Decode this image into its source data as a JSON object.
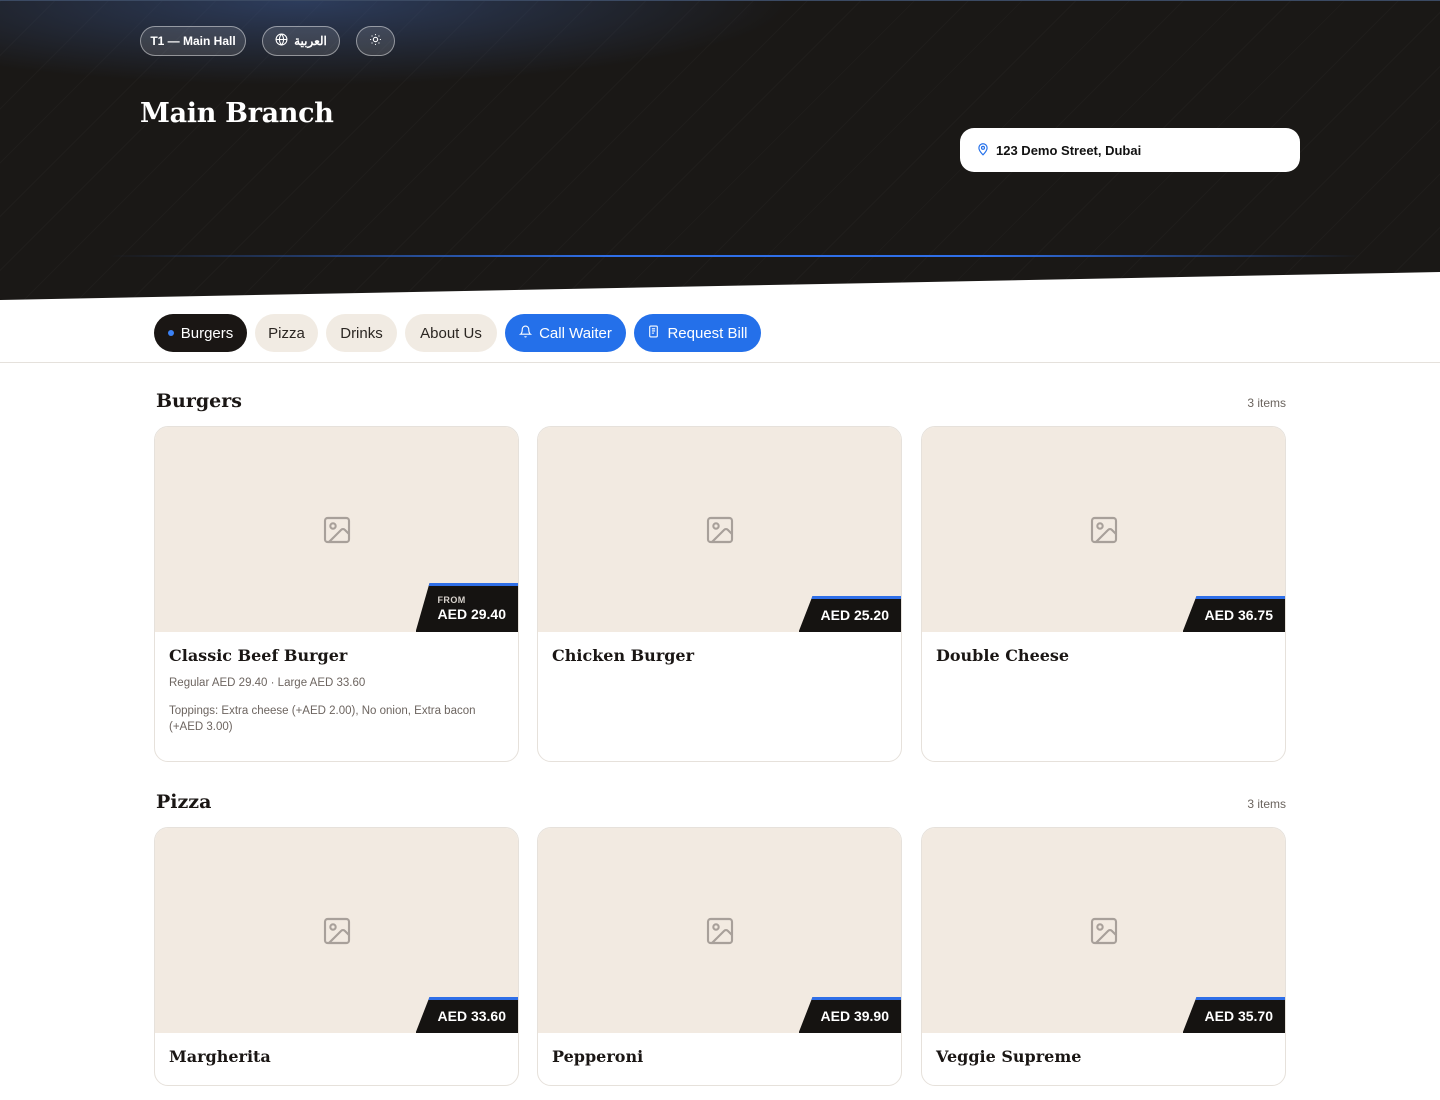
{
  "header": {
    "table_label": "T1 — Main Hall",
    "language_label": "العربية",
    "branch_title": "Main Branch",
    "address": "123 Demo Street, Dubai"
  },
  "nav": {
    "tabs": [
      {
        "label": "Burgers",
        "active": true
      },
      {
        "label": "Pizza"
      },
      {
        "label": "Drinks"
      },
      {
        "label": "About Us"
      }
    ],
    "call_waiter_label": "Call Waiter",
    "request_bill_label": "Request Bill"
  },
  "sections": [
    {
      "title": "Burgers",
      "count": "3 items",
      "items": [
        {
          "name": "Classic Beef Burger",
          "price_prefix": "FROM",
          "price": "AED 29.40",
          "variants": "Regular AED 29.40 · Large AED 33.60",
          "toppings": "Toppings: Extra cheese (+AED 2.00), No onion, Extra bacon (+AED 3.00)"
        },
        {
          "name": "Chicken Burger",
          "price": "AED 25.20"
        },
        {
          "name": "Double Cheese",
          "price": "AED 36.75"
        }
      ]
    },
    {
      "title": "Pizza",
      "count": "3 items",
      "items": [
        {
          "name": "Margherita",
          "price": "AED 33.60"
        },
        {
          "name": "Pepperoni",
          "price": "AED 39.90"
        },
        {
          "name": "Veggie Supreme",
          "price": "AED 35.70"
        }
      ]
    }
  ],
  "icons": {
    "language": "globe-icon",
    "theme": "sun-icon",
    "address": "map-pin-icon",
    "call_waiter": "bell-icon",
    "request_bill": "receipt-icon",
    "image_placeholder": "image-placeholder-icon"
  },
  "colors": {
    "accent_blue": "#2470ea",
    "hero_dark": "#1a1816",
    "card_image_bg": "#f2eae1",
    "price_tag_bg": "#151311"
  }
}
